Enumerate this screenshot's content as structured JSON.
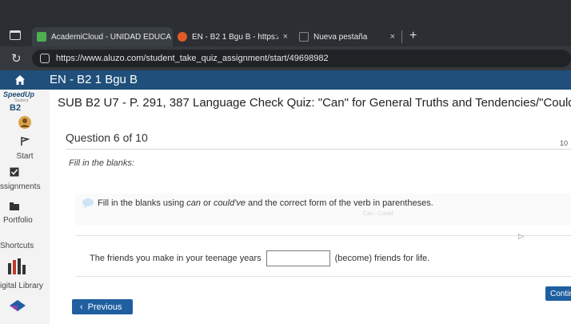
{
  "browser": {
    "tabs": [
      {
        "title": "AcademiCloud - UNIDAD EDUCA",
        "icon_color": "#4caf50",
        "active": true
      },
      {
        "title": "EN - B2 1 Bgu B - https://www.alu",
        "icon_color": "#e05a2a",
        "active": false
      },
      {
        "title": "Nueva pestaña",
        "icon_color": "#888888",
        "active": false
      }
    ],
    "close_glyph": "×",
    "new_tab_glyph": "+",
    "url": "https://www.aluzo.com/student_take_quiz_assignment/start/49698982"
  },
  "app": {
    "title": "EN - B2 1 Bgu B",
    "header_color": "#1f4f7a",
    "accent_color": "#1f5fa0"
  },
  "sidebar": {
    "logo": {
      "name": "SpeedUp",
      "subtitle": "Student",
      "level": "B2"
    },
    "items": [
      {
        "label": "Start",
        "icon": "flag-icon"
      },
      {
        "label": "ssignments",
        "icon": "checkbox-icon"
      },
      {
        "label": "Portfolio",
        "icon": "folder-icon"
      },
      {
        "label": "Shortcuts",
        "icon": "bars-icon"
      },
      {
        "label": "igital Library",
        "icon": "book-icon"
      }
    ]
  },
  "quiz": {
    "title": "SUB B2 U7 - P. 291, 387 Language Check Quiz: \"Can\" for General Truths and Tendencies/\"Could\" for ...",
    "question": "Question 6 of 10",
    "page_count": "10",
    "instruction": "Fill in the blanks:",
    "directions_pre": "Fill in the blanks using ",
    "directions_can": "can",
    "directions_or": " or ",
    "directions_couldve": "could've",
    "directions_post": " and the correct form of the verb in parentheses.",
    "watermark": "Can - Could",
    "sentence_before": "The friends you make in your teenage years",
    "blank_value": "",
    "sentence_after": "(become) friends for life."
  },
  "buttons": {
    "continue": "Contin",
    "previous": "Previous",
    "previous_glyph": "‹"
  }
}
